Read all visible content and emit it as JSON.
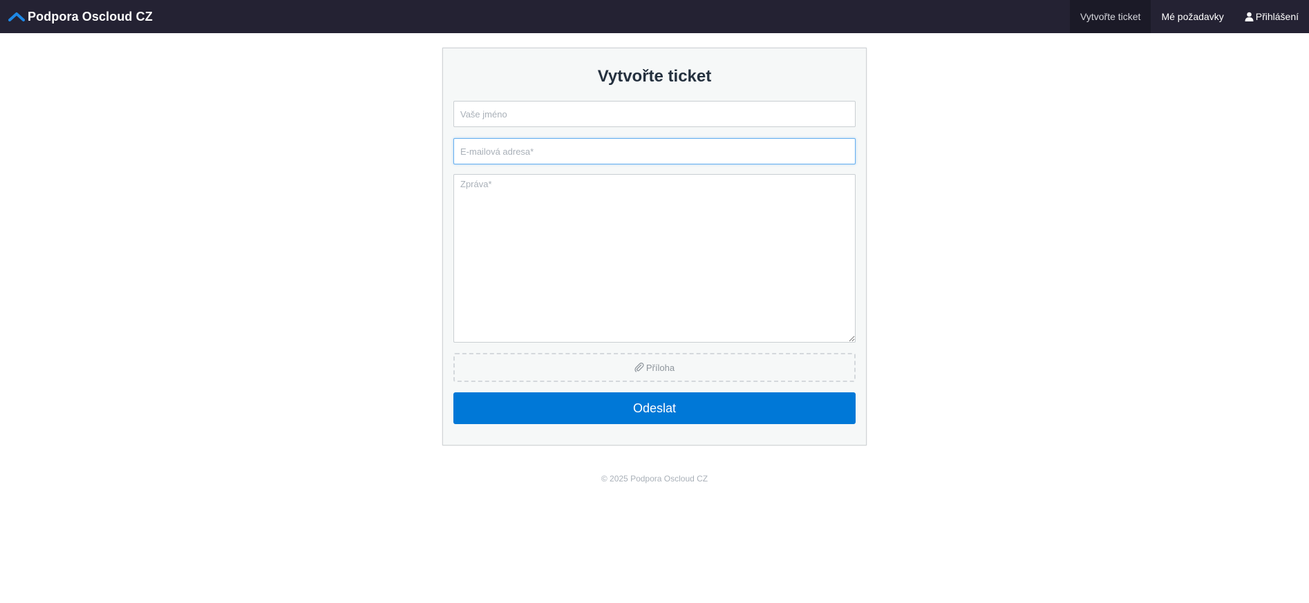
{
  "navbar": {
    "brand": "Podpora Oscloud CZ",
    "brand_icon": "chevron-up-icon",
    "links": [
      {
        "label": "Vytvořte ticket",
        "active": true
      },
      {
        "label": "Mé požadavky",
        "active": false
      },
      {
        "label": "Přihlášení",
        "icon": "user-icon",
        "active": false
      }
    ]
  },
  "form": {
    "title": "Vytvořte ticket",
    "name_placeholder": "Vaše jméno",
    "email_placeholder": "E-mailová adresa*",
    "message_placeholder": "Zpráva*",
    "attachment_label": "Příloha",
    "attachment_icon": "paperclip-icon",
    "submit_label": "Odeslat"
  },
  "footer": {
    "text": "© 2025 Podpora Oscloud CZ"
  },
  "colors": {
    "navbar_bg": "#242233",
    "accent": "#0078d7",
    "logo": "#1e88e5"
  }
}
